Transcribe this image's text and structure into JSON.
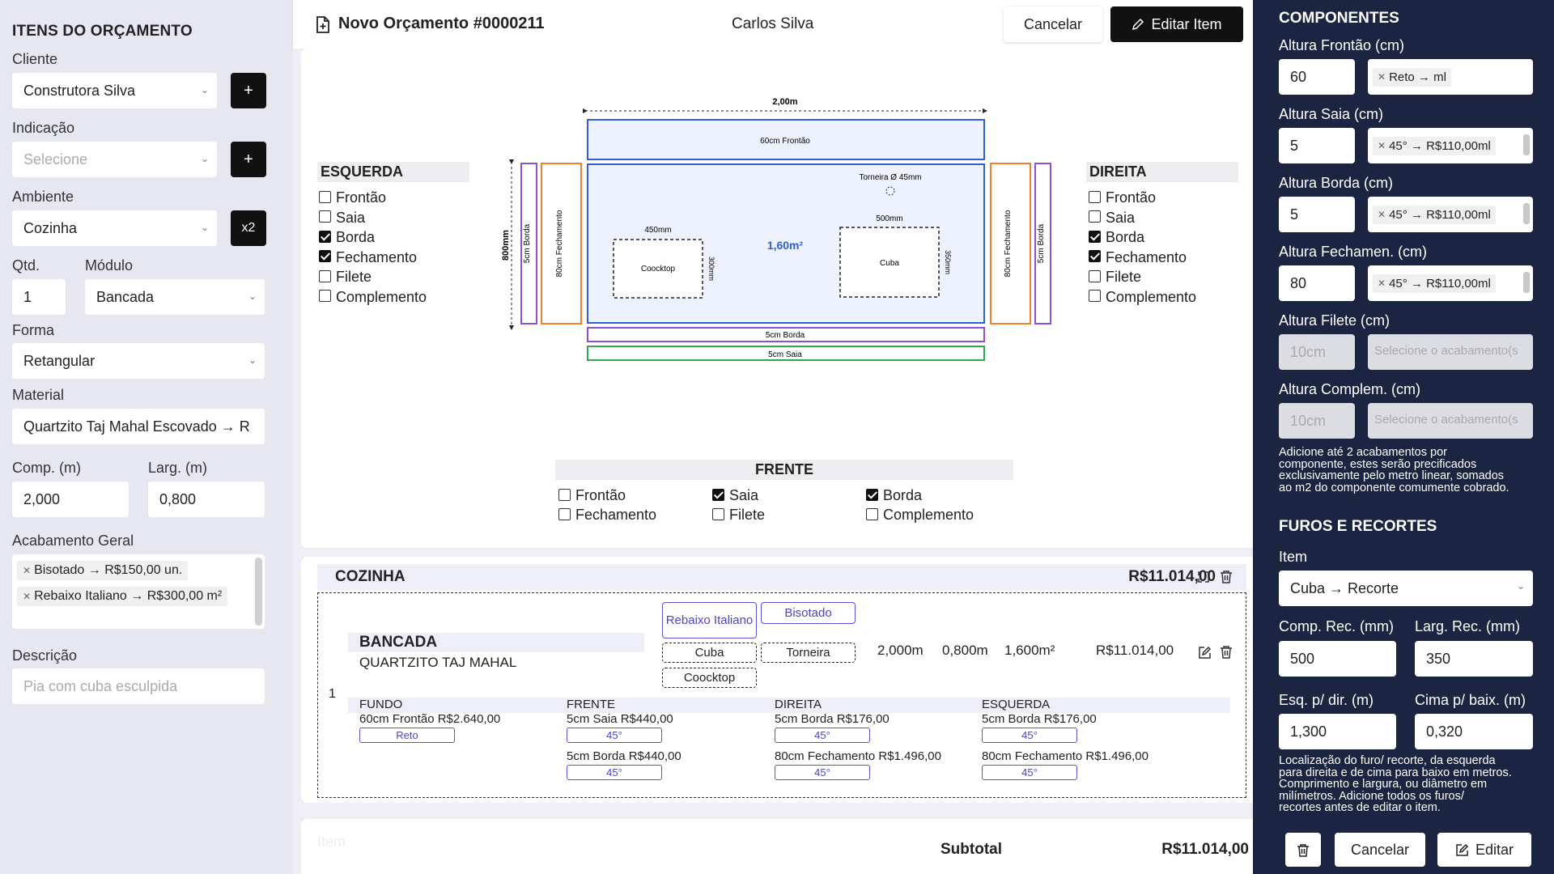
{
  "sidebar": {
    "title": "ITENS DO ORÇAMENTO",
    "cliente_label": "Cliente",
    "cliente_value": "Construtora Silva",
    "add": "+",
    "indicacao_label": "Indicação",
    "indicacao_placeholder": "Selecione",
    "ambiente_label": "Ambiente",
    "ambiente_value": "Cozinha",
    "dup": "x2",
    "qtd_label": "Qtd.",
    "qtd_value": "1",
    "modulo_label": "Módulo",
    "modulo_value": "Bancada",
    "forma_label": "Forma",
    "forma_value": "Retangular",
    "material_label": "Material",
    "material_value": "Quartzito Taj Mahal Escovado → R",
    "comp_label": "Comp. (m)",
    "comp_value": "2,000",
    "larg_label": "Larg. (m)",
    "larg_value": "0,800",
    "acab_label": "Acabamento Geral",
    "acab_tags": [
      "Bisotado → R$150,00 un.",
      "Rebaixo Italiano → R$300,00 m²"
    ],
    "desc_label": "Descrição",
    "desc_placeholder": "Pia com cuba esculpida"
  },
  "topbar": {
    "title": "Novo Orçamento #0000211",
    "client": "Carlos Silva",
    "cancel": "Cancelar",
    "edit": "Editar Item"
  },
  "drawing": {
    "width_label": "2,00m",
    "depth_label": "800mm",
    "frontao": "60cm Frontão",
    "torneira": "Torneira Ø 45mm",
    "area": "1,60m²",
    "cooktop": "Coocktop",
    "cooktop_w": "450mm",
    "cooktop_h": "300mm",
    "cuba": "Cuba",
    "cuba_w": "500mm",
    "cuba_h": "350mm",
    "left_borda": "5cm Borda",
    "left_fech": "80cm Fechamento",
    "right_fech": "80cm Fechamento",
    "right_borda": "5cm Borda",
    "front_borda": "5cm Borda",
    "front_saia": "5cm Saia"
  },
  "esquerda": {
    "title": "ESQUERDA",
    "items": [
      [
        "Frontão",
        false
      ],
      [
        "Saia",
        false
      ],
      [
        "Borda",
        true
      ],
      [
        "Fechamento",
        true
      ],
      [
        "Filete",
        false
      ],
      [
        "Complemento",
        false
      ]
    ]
  },
  "direita": {
    "title": "DIREITA",
    "items": [
      [
        "Frontão",
        false
      ],
      [
        "Saia",
        false
      ],
      [
        "Borda",
        true
      ],
      [
        "Fechamento",
        true
      ],
      [
        "Filete",
        false
      ],
      [
        "Complemento",
        false
      ]
    ]
  },
  "frente": {
    "title": "FRENTE",
    "items": [
      [
        "Frontão",
        false
      ],
      [
        "Saia",
        true
      ],
      [
        "Borda",
        true
      ],
      [
        "Fechamento",
        false
      ],
      [
        "Filete",
        false
      ],
      [
        "Complemento",
        false
      ]
    ]
  },
  "item": {
    "room": "COZINHA",
    "room_total": "R$11.014,00",
    "qty": "1",
    "name": "BANCADA",
    "material": "QUARTZITO TAJ MAHAL",
    "chips": [
      "Rebaixo Italiano",
      "Bisotado"
    ],
    "cutouts": [
      "Cuba",
      "Torneira",
      "Coocktop"
    ],
    "comp": "2,000m",
    "larg": "0,800m",
    "area": "1,600m²",
    "price": "R$11.014,00",
    "cols": [
      {
        "h": "FUNDO",
        "lines": [
          {
            "t": "60cm Frontão R$2.640,00",
            "tag": "Reto"
          }
        ]
      },
      {
        "h": "FRENTE",
        "lines": [
          {
            "t": "5cm Saia R$440,00",
            "tag": "45°"
          },
          {
            "t": "5cm Borda R$440,00",
            "tag": "45°"
          }
        ]
      },
      {
        "h": "DIREITA",
        "lines": [
          {
            "t": "5cm Borda R$176,00",
            "tag": "45°"
          },
          {
            "t": "80cm Fechamento R$1.496,00",
            "tag": "45°"
          }
        ]
      },
      {
        "h": "ESQUERDA",
        "lines": [
          {
            "t": "5cm Borda R$176,00",
            "tag": "45°"
          },
          {
            "t": "80cm Fechamento R$1.496,00",
            "tag": "45°"
          }
        ]
      }
    ]
  },
  "footer": {
    "item_placeholder": "Item",
    "subtotal_label": "Subtotal",
    "subtotal_value": "R$11.014,00"
  },
  "componentes": {
    "title": "COMPONENTES",
    "fields": [
      {
        "label": "Altura Frontão (cm)",
        "value": "60",
        "tag": "Reto → ml",
        "scroll": false,
        "disabled": false
      },
      {
        "label": "Altura Saia (cm)",
        "value": "5",
        "tag": "45° → R$110,00ml",
        "scroll": true,
        "disabled": false
      },
      {
        "label": "Altura Borda (cm)",
        "value": "5",
        "tag": "45° → R$110,00ml",
        "scroll": true,
        "disabled": false
      },
      {
        "label": "Altura Fechamen. (cm)",
        "value": "80",
        "tag": "45° → R$110,00ml",
        "scroll": true,
        "disabled": false
      },
      {
        "label": "Altura Filete (cm)",
        "value": "10cm",
        "tag": "Selecione o acabamento(s",
        "scroll": false,
        "disabled": true
      },
      {
        "label": "Altura Complem. (cm)",
        "value": "10cm",
        "tag": "Selecione o acabamento(s",
        "scroll": false,
        "disabled": true
      }
    ],
    "help": [
      "Adicione até 2 acabamentos por",
      "componente, estes serão precificados",
      "exclusivamente pelo metro linear, somados",
      "ao m2 do componente comumente cobrado."
    ]
  },
  "furos": {
    "title": "FUROS E RECORTES",
    "item_label": "Item",
    "item_value": "Cuba → Recorte",
    "comp_label": "Comp. Rec. (mm)",
    "comp_value": "500",
    "larg_label": "Larg. Rec. (mm)",
    "larg_value": "350",
    "esq_label": "Esq. p/ dir. (m)",
    "esq_value": "1,300",
    "cima_label": "Cima p/ baix. (m)",
    "cima_value": "0,320",
    "help": [
      "Localização do furo/ recorte, da esquerda",
      "para direita e de cima para baixo em metros.",
      "Comprimento e largura, ou diâmetro em",
      "milímetros. Adicione todos os furos/",
      "recortes antes de editar o item."
    ],
    "cancel": "Cancelar",
    "edit": "Editar"
  }
}
